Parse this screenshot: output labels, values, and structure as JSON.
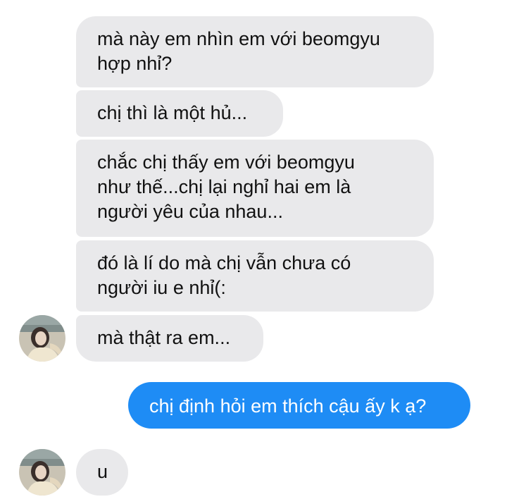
{
  "conversation": {
    "messages": [
      {
        "text": "mà này em nhìn em với beomgyu\nhợp nhỉ?",
        "sender": "other"
      },
      {
        "text": "chị thì là một hủ...",
        "sender": "other"
      },
      {
        "text": "chắc chị thấy em với beomgyu\nnhư thế...chị lại nghỉ hai em là\nngười yêu của nhau...",
        "sender": "other"
      },
      {
        "text": "đó là lí do mà chị vẫn chưa có\nngười iu e nhỉ(:",
        "sender": "other"
      },
      {
        "text": "mà thật ra em...",
        "sender": "other"
      },
      {
        "text": "chị định hỏi em thích cậu ấy k ạ?",
        "sender": "me"
      },
      {
        "text": "u",
        "sender": "other"
      }
    ]
  },
  "colors": {
    "incoming_bubble": "#e9e9eb",
    "outgoing_bubble": "#1e8cf5",
    "outgoing_text": "#ffffff",
    "incoming_text": "#111111"
  },
  "icons": {
    "contact_avatar": "contact-avatar-photo"
  }
}
